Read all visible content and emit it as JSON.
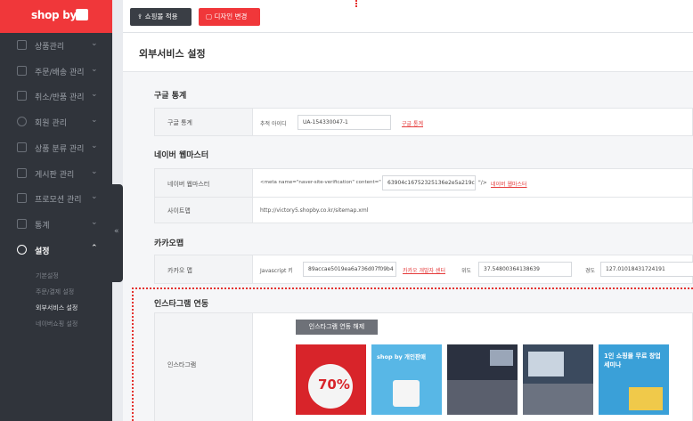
{
  "logo": {
    "text": "shop by"
  },
  "topbar": {
    "apply_label": "쇼핑몰 적용",
    "design_label": "디자인 변경"
  },
  "sidebar": {
    "items": [
      {
        "label": "상품관리"
      },
      {
        "label": "주문/배송 관리"
      },
      {
        "label": "취소/반품 관리"
      },
      {
        "label": "회원 관리"
      },
      {
        "label": "상품 분류 관리"
      },
      {
        "label": "게시판 관리"
      },
      {
        "label": "프로모션 관리"
      },
      {
        "label": "통계"
      },
      {
        "label": "설정"
      }
    ],
    "sub_items": [
      {
        "label": "기본설정"
      },
      {
        "label": "주문/결제 설정"
      },
      {
        "label": "외부서비스 설정"
      },
      {
        "label": "네이버쇼핑 설정"
      }
    ],
    "collapse_icon": "«"
  },
  "page": {
    "title": "외부서비스 설정"
  },
  "google": {
    "section_title": "구글 통계",
    "row_label": "구글 통계",
    "tracking_label": "추적 아이디",
    "tracking_value": "UA-154330047-1",
    "link": "구글 통계"
  },
  "naver": {
    "section_title": "네이버 웹마스터",
    "row_label": "네이버 웹마스터",
    "meta_prefix": "<meta name=\"naver-site-verification\" content=\"",
    "meta_value": "63904c16752325136e2e5a219c",
    "meta_suffix": "\"/>",
    "link": "네이버 웹마스터",
    "sitemap_label": "사이트맵",
    "sitemap_value": "http://victory5.shopby.co.kr/sitemap.xml"
  },
  "kakao": {
    "section_title": "카카오맵",
    "row_label": "카카오 맵",
    "js_label": "Javascript 키",
    "js_value": "89accae5019ea6a736d07f09b4",
    "dev_link": "카카오 개발자 센터",
    "lat_label": "위도",
    "lat_value": "37.54800364138639",
    "lng_label": "경도",
    "lng_value": "127.01018431724191"
  },
  "instagram": {
    "section_title": "인스타그램 연동",
    "row_label": "인스타그램",
    "disconnect_label": "인스타그램 연동 해제",
    "thumbs": [
      {
        "text": "70%"
      },
      {
        "text": "shop by 개인판매"
      },
      {
        "text": ""
      },
      {
        "text": ""
      },
      {
        "text": "1인 쇼핑몰 무료 창업세미나"
      }
    ]
  },
  "colors": {
    "accent": "#f0373a",
    "sidebar": "#30343b"
  }
}
